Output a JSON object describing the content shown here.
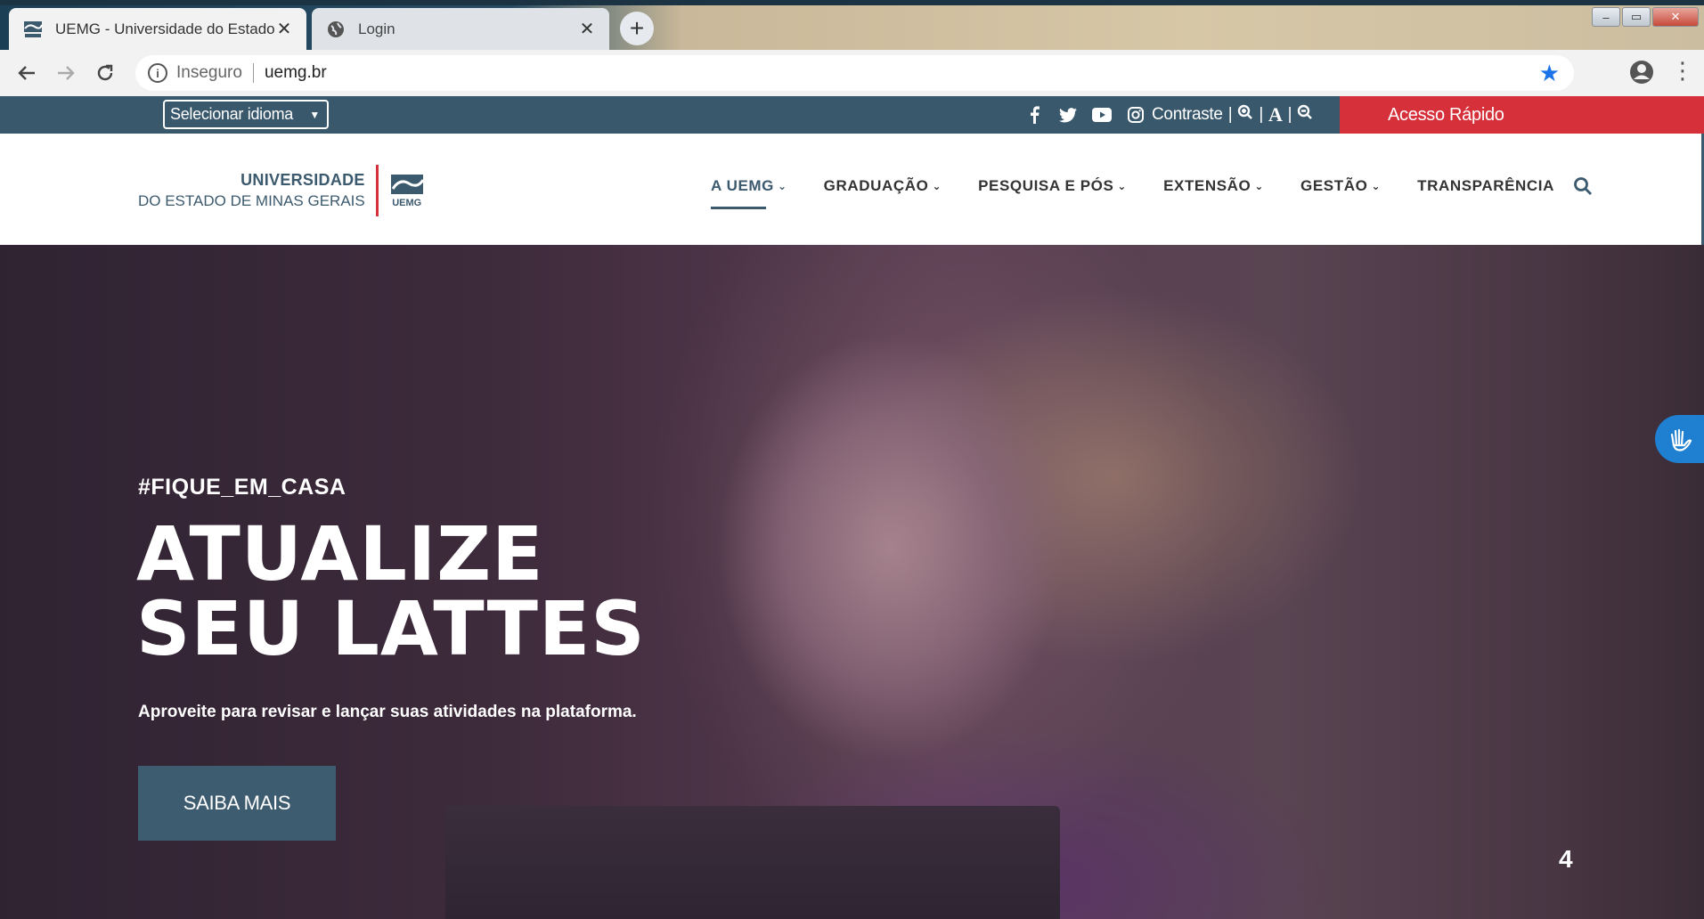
{
  "browser": {
    "tabs": [
      {
        "title": "UEMG - Universidade do Estado",
        "close": "✕",
        "active": true
      },
      {
        "title": "Login",
        "close": "✕",
        "active": false
      }
    ],
    "new_tab": "+",
    "address": {
      "security_label": "Inseguro",
      "url": "uemg.br"
    },
    "window_buttons": {
      "minimize": "–",
      "maximize": "▭",
      "close": "✕"
    }
  },
  "topbar": {
    "language_select": "Selecionar idioma",
    "social_icons": [
      "facebook-icon",
      "twitter-icon",
      "youtube-icon",
      "instagram-icon"
    ],
    "contrast_label": "Contraste",
    "font_controls": [
      "|",
      "|",
      "A",
      "|"
    ],
    "quick_access": "Acesso Rápido",
    "colors": {
      "bar": "#39586c",
      "accent": "#d6303b"
    }
  },
  "header": {
    "logo": {
      "line1": "UNIVERSIDADE",
      "line2": "DO ESTADO DE MINAS GERAIS",
      "mark_text": "UEMG"
    },
    "nav": [
      {
        "label": "A UEMG",
        "dropdown": true,
        "active": true
      },
      {
        "label": "GRADUAÇÃO",
        "dropdown": true,
        "active": false
      },
      {
        "label": "PESQUISA E PÓS",
        "dropdown": true,
        "active": false
      },
      {
        "label": "EXTENSÃO",
        "dropdown": true,
        "active": false
      },
      {
        "label": "GESTÃO",
        "dropdown": true,
        "active": false
      },
      {
        "label": "TRANSPARÊNCIA",
        "dropdown": false,
        "active": false
      }
    ]
  },
  "hero": {
    "tag": "#FIQUE_EM_CASA",
    "title_line1": "ATUALIZE",
    "title_line2": "SEU LATTES",
    "subtitle": "Aproveite para revisar e lançar suas atividades na plataforma.",
    "button": "SAIBA MAIS",
    "slide_number": "4"
  }
}
